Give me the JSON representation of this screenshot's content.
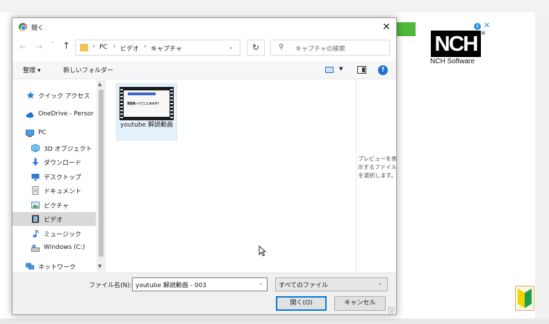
{
  "background": {
    "ad_info_glyph": "i",
    "ad_close_glyph": "✕",
    "logo_text": "NCH",
    "logo_registered": "®",
    "brand_text": "NCH Software",
    "accent_green": "#4fb83a"
  },
  "dialog": {
    "title": "開く",
    "close_glyph": "✕",
    "nav": {
      "back_glyph": "←",
      "forward_glyph": "→",
      "history_glyph": "˅",
      "up_glyph": "↑",
      "breadcrumb": [
        "PC",
        "ビデオ",
        "キャプチャ"
      ],
      "crumb_separator": "›",
      "address_dropdown_glyph": "⌄",
      "refresh_glyph": "↻",
      "search_glyph": "⚲",
      "search_placeholder": "キャプチャの検索"
    },
    "toolbar": {
      "organize_label": "整理 ▾",
      "new_folder_label": "新しいフォルダー",
      "view_dropdown_glyph": "▼",
      "help_glyph": "?"
    },
    "sidebar": {
      "items": [
        {
          "label": "クイック アクセス",
          "icon": "star-icon"
        },
        {
          "label": "OneDrive - Persor",
          "icon": "cloud-icon"
        },
        {
          "label": "PC",
          "icon": "pc-icon"
        },
        {
          "label": "3D オブジェクト",
          "icon": "cube-icon"
        },
        {
          "label": "ダウンロード",
          "icon": "download-icon"
        },
        {
          "label": "デスクトップ",
          "icon": "desktop-icon"
        },
        {
          "label": "ドキュメント",
          "icon": "document-icon"
        },
        {
          "label": "ピクチャ",
          "icon": "picture-icon"
        },
        {
          "label": "ビデオ",
          "icon": "video-icon",
          "selected": true
        },
        {
          "label": "ミュージック",
          "icon": "music-icon"
        },
        {
          "label": "Windows (C:)",
          "icon": "drive-icon"
        },
        {
          "label": "ネットワーク",
          "icon": "network-icon"
        }
      ],
      "scroll_up_glyph": "▲",
      "scroll_down_glyph": "▼"
    },
    "files": [
      {
        "name": "youtube 解説動画",
        "thumb_caption": "履歴書ってどこにあるの？"
      }
    ],
    "preview_text": "プレビューを表示するファイルを選択します。",
    "filename_label": "ファイル名(N):",
    "filename_value": "youtube 解説動画 - 003",
    "dropdown_glyph": "⌄",
    "filetype_value": "すべてのファイル",
    "open_button": "開く(O)",
    "cancel_button": "キャンセル"
  }
}
